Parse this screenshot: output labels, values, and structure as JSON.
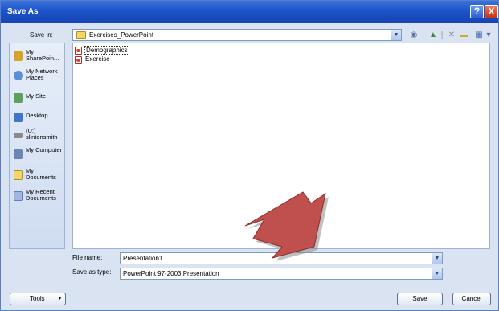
{
  "window": {
    "title": "Save As"
  },
  "title_buttons": {
    "help": "?",
    "close": "X"
  },
  "save_in": {
    "label": "Save in:",
    "value": "Exercises_PowerPoint"
  },
  "places": [
    {
      "label": "My SharePoin..."
    },
    {
      "label": "My Network Places"
    },
    {
      "label": "My Site"
    },
    {
      "label": "Desktop"
    },
    {
      "label": "(U:) slintonsmith"
    },
    {
      "label": "My Computer"
    },
    {
      "label": "My Documents"
    },
    {
      "label": "My Recent Documents"
    }
  ],
  "files": [
    {
      "name": "Demographics",
      "selected": true
    },
    {
      "name": "Exercise",
      "selected": false
    }
  ],
  "file_name": {
    "label": "File name:",
    "value": "Presentation1"
  },
  "save_as_type": {
    "label": "Save as type:",
    "value": "PowerPoint 97-2003 Presentation"
  },
  "buttons": {
    "tools": "Tools",
    "save": "Save",
    "cancel": "Cancel"
  },
  "colors": {
    "titlebar": "#1c54c9",
    "arrow": "#c0504d",
    "panel": "#d9e3f1"
  }
}
